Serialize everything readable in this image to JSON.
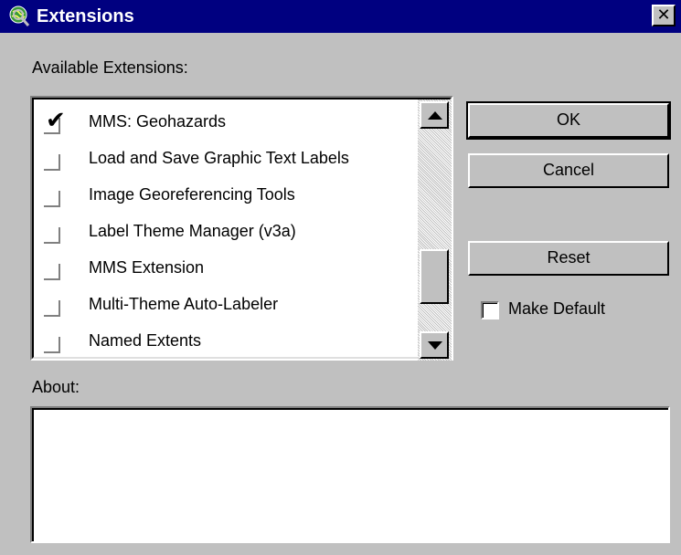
{
  "window": {
    "title": "Extensions",
    "close_label": "✕",
    "icon": "globe-magnifier-icon",
    "title_bar_color": "#000080",
    "face_color": "#c0c0c0"
  },
  "labels": {
    "available": "Available Extensions:",
    "about": "About:"
  },
  "extensions": [
    {
      "label": "MMS: Geohazards",
      "checked": true
    },
    {
      "label": "Load and Save Graphic Text Labels",
      "checked": false
    },
    {
      "label": "Image Georeferencing Tools",
      "checked": false
    },
    {
      "label": "Label Theme Manager (v3a)",
      "checked": false
    },
    {
      "label": "MMS Extension",
      "checked": false
    },
    {
      "label": "Multi-Theme Auto-Labeler",
      "checked": false
    },
    {
      "label": "Named Extents",
      "checked": false
    }
  ],
  "check_mark": "✔",
  "buttons": {
    "ok": "OK",
    "cancel": "Cancel",
    "reset": "Reset"
  },
  "make_default": {
    "label": "Make Default",
    "checked": false
  },
  "about_text": ""
}
